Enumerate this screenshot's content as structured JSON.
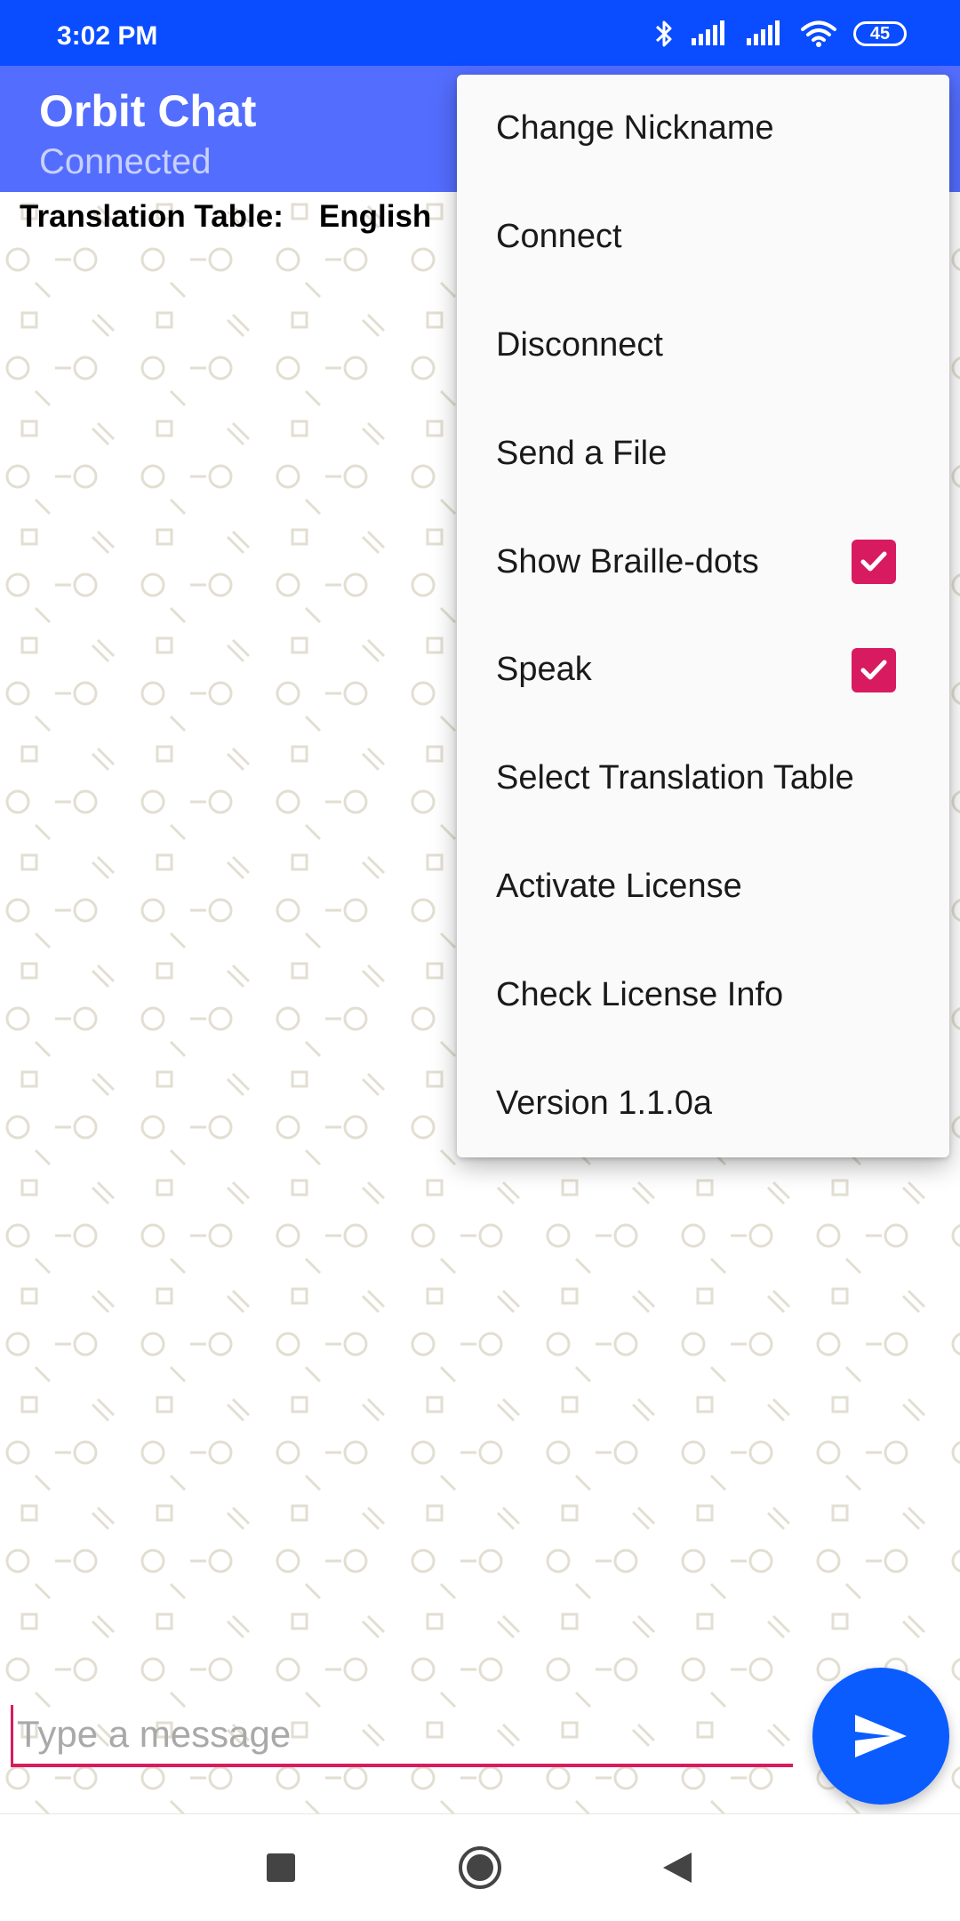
{
  "status_bar": {
    "time": "3:02 PM",
    "battery": "45",
    "icons": [
      "bluetooth-icon",
      "signal-icon",
      "signal-icon",
      "wifi-icon",
      "battery-icon"
    ]
  },
  "app_bar": {
    "title": "Orbit Chat",
    "subtitle": "Connected",
    "color": "#536dfe"
  },
  "translation": {
    "label": "Translation Table:",
    "value": "English"
  },
  "menu": {
    "items": [
      {
        "label": "Change Nickname"
      },
      {
        "label": "Connect"
      },
      {
        "label": "Disconnect"
      },
      {
        "label": "Send a File"
      },
      {
        "label": "Show Braille-dots",
        "checked": true
      },
      {
        "label": "Speak",
        "checked": true
      },
      {
        "label": "Select Translation Table"
      },
      {
        "label": "Activate License"
      },
      {
        "label": "Check License Info"
      },
      {
        "label": "Version 1.1.0a"
      }
    ]
  },
  "composer": {
    "placeholder": "Type a message",
    "accent": "#d81b60",
    "send_icon": "send-icon",
    "send_color": "#0a5cff"
  },
  "nav_bar": {
    "icons": [
      "recents-icon",
      "home-icon",
      "back-icon"
    ]
  }
}
